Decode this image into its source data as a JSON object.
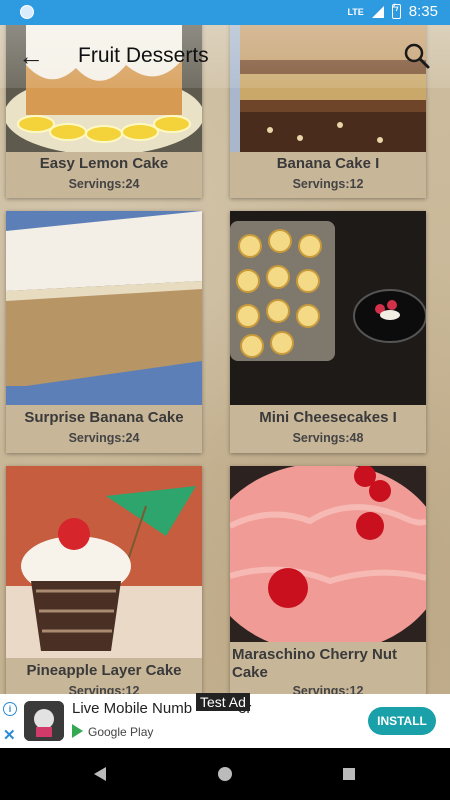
{
  "status_bar": {
    "network": "LTE",
    "time": "8:35"
  },
  "toolbar": {
    "title": "Fruit Desserts"
  },
  "recipes": [
    {
      "name": "Easy Lemon Cake",
      "servings": "Servings:24"
    },
    {
      "name": "Banana Cake I",
      "servings": "Servings:12"
    },
    {
      "name": "Surprise Banana Cake",
      "servings": "Servings:24"
    },
    {
      "name": "Mini Cheesecakes I",
      "servings": "Servings:48"
    },
    {
      "name": "Pineapple Layer Cake",
      "servings": "Servings:12"
    },
    {
      "name": "Maraschino Cherry Nut Cake",
      "servings": "Servings:12"
    }
  ],
  "ad": {
    "title": "Live Mobile Numb",
    "title_end": "er",
    "badge": "Test Ad",
    "store": "Google Play",
    "cta": "INSTALL"
  },
  "colors": {
    "status_bar": "#2e9ae0",
    "install": "#19a0a8"
  }
}
